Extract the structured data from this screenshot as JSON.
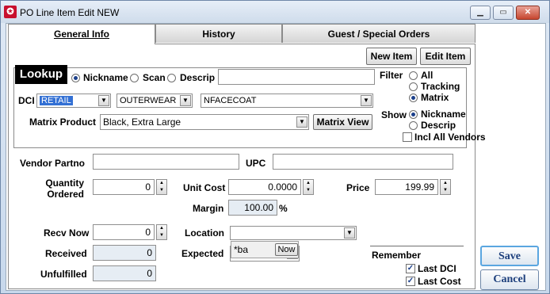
{
  "window": {
    "title": "PO Line Item Edit NEW"
  },
  "tabs": [
    {
      "label": "General Info"
    },
    {
      "label": "History"
    },
    {
      "label": "Guest / Special Orders"
    }
  ],
  "toolbar": {
    "new_item": "New Item",
    "edit_item": "Edit Item"
  },
  "lookup": {
    "tag": "Lookup",
    "modes": [
      "Nickname",
      "Scan",
      "Descrip"
    ],
    "selected_mode": "Nickname",
    "search_value": ""
  },
  "filter": {
    "label": "Filter",
    "options": [
      "All",
      "Tracking",
      "Matrix"
    ],
    "selected": "Matrix"
  },
  "show": {
    "label": "Show",
    "options": [
      "Nickname",
      "Descrip"
    ],
    "selected": "Nickname",
    "incl_all_vendors": "Incl All Vendors"
  },
  "dci": {
    "label": "DCI",
    "dept": "RETAIL",
    "class": "OUTERWEAR",
    "item": "NFACECOAT"
  },
  "matrix": {
    "label": "Matrix Product",
    "value": "Black, Extra Large",
    "button": "Matrix View"
  },
  "fields": {
    "vendor_partno_label": "Vendor Partno",
    "vendor_partno": "",
    "upc_label": "UPC",
    "upc": "",
    "qty_ordered_label_1": "Quantity",
    "qty_ordered_label_2": "Ordered",
    "qty_ordered": "0",
    "unit_cost_label": "Unit Cost",
    "unit_cost": "0.0000",
    "price_label": "Price",
    "price": "199.99",
    "margin_label": "Margin",
    "margin": "100.00",
    "margin_unit": "%",
    "recv_now_label": "Recv Now",
    "recv_now": "0",
    "location_label": "Location",
    "location": "",
    "received_label": "Received",
    "received": "0",
    "expected_label": "Expected",
    "expected": "- -",
    "expected_hint": "*ba",
    "now_button": "Now",
    "unfulfilled_label": "Unfulfilled",
    "unfulfilled": "0"
  },
  "remember": {
    "label": "Remember",
    "last_dci": "Last DCI",
    "last_cost": "Last Cost"
  },
  "actions": {
    "save": "Save",
    "cancel": "Cancel"
  }
}
